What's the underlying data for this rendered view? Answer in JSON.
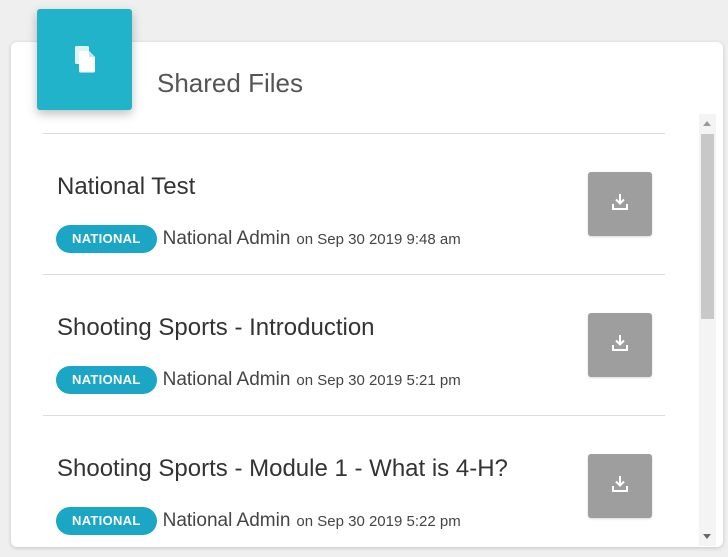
{
  "header": {
    "title": "Shared Files",
    "icon": "file-copy-icon",
    "accent_color": "#20b3c9"
  },
  "files": [
    {
      "name": "National Test",
      "badge": "NATIONAL",
      "author": "National Admin",
      "date": "on Sep 30 2019 9:48 am"
    },
    {
      "name": "Shooting Sports - Introduction",
      "badge": "NATIONAL",
      "author": "National Admin",
      "date": "on Sep 30 2019 5:21 pm"
    },
    {
      "name": "Shooting Sports - Module 1 - What is 4-H?",
      "badge": "NATIONAL",
      "author": "National Admin",
      "date": "on Sep 30 2019 5:22 pm"
    }
  ],
  "colors": {
    "badge": "#1aa6c4",
    "download_button": "#9e9e9e"
  }
}
